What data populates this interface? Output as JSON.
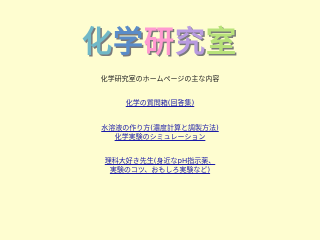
{
  "banner": {
    "title": "化学研究室",
    "colors": [
      "#6fb8c7",
      "#5a8cc8",
      "#ff9ad0",
      "#b89be0",
      "#b8e27a"
    ]
  },
  "subtitle": "化学研究室のホームページの主な内容",
  "links": [
    {
      "label": "化学の質問箱(回答集)"
    },
    {
      "label": "水溶液の作り方(濃度計算と調製方法)"
    },
    {
      "label": "化学実験のシミュレーション"
    },
    {
      "label": "理科大好き先生(身近なpH指示薬、"
    },
    {
      "label": "実験のコツ、おもしろ実験など)"
    }
  ]
}
